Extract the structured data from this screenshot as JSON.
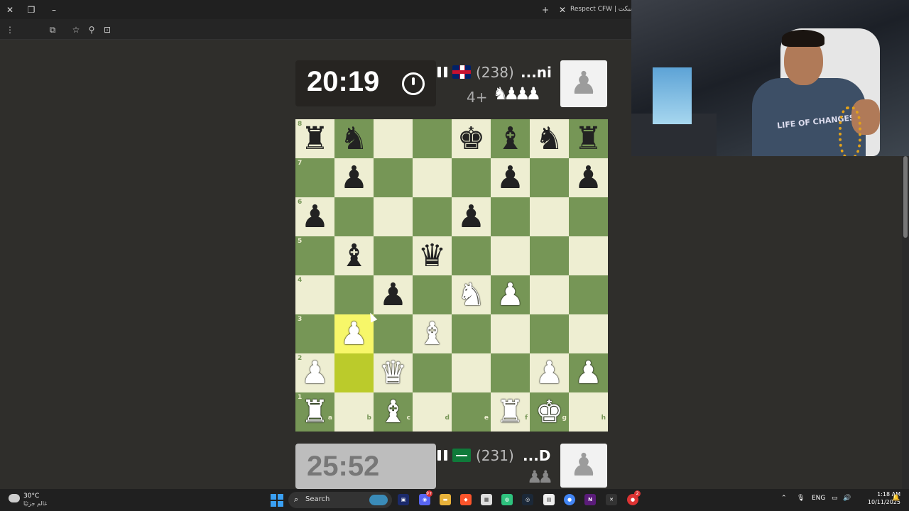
{
  "browser": {
    "tab_title": "Respect CFW | ريسبكت",
    "colors": {
      "frame": "#202020",
      "toolbar": "#252525"
    }
  },
  "game": {
    "top_player": {
      "clock": "20:19",
      "rating": "(238)",
      "name": "...ni",
      "advantage": "4+",
      "captured": "♞♟♟♟",
      "country": "GB"
    },
    "bottom_player": {
      "clock": "25:52",
      "rating": "(231)",
      "name": "...D",
      "captured": "♟♟",
      "country": "SA"
    },
    "board": {
      "colors": {
        "light": "#eeeed2",
        "dark": "#769656",
        "highlight_light": "#f7f769",
        "highlight_dark": "#bbcb2b"
      },
      "files": [
        "a",
        "b",
        "c",
        "d",
        "e",
        "f",
        "g",
        "h"
      ],
      "ranks": [
        "8",
        "7",
        "6",
        "5",
        "4",
        "3",
        "2",
        "1"
      ],
      "position": [
        [
          "bR",
          "bN",
          "",
          "",
          "bK",
          "bB",
          "bN",
          "bR"
        ],
        [
          "",
          "bP",
          "",
          "",
          "",
          "bP",
          "",
          "bP"
        ],
        [
          "bP",
          "",
          "",
          "",
          "bP",
          "",
          "",
          ""
        ],
        [
          "",
          "bB",
          "",
          "bQ",
          "",
          "",
          "",
          ""
        ],
        [
          "",
          "",
          "bP",
          "",
          "wN",
          "wP",
          "",
          ""
        ],
        [
          "",
          "wP",
          "",
          "wB",
          "",
          "",
          "",
          ""
        ],
        [
          "wP",
          "",
          "wQ",
          "",
          "",
          "",
          "wP",
          "wP"
        ],
        [
          "wR",
          "",
          "wB",
          "",
          "",
          "wR",
          "wK",
          ""
        ]
      ],
      "highlighted": [
        "b3",
        "b2"
      ]
    }
  },
  "webcam": {
    "shirt_text": "LIFE OF CHANGES"
  },
  "taskbar": {
    "weather_temp": "30°C",
    "weather_desc": "غالم جزئيًا",
    "search_placeholder": "Search",
    "language": "ENG",
    "time": "1:18 AM",
    "date": "10/11/2025",
    "badges": {
      "discord": "9+",
      "app_red": "2"
    }
  }
}
